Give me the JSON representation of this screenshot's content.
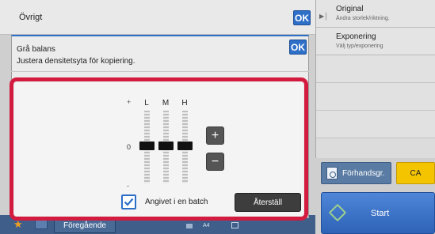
{
  "background": {
    "title": "Övrigt",
    "ok_label": "OK",
    "right_panel": {
      "items": [
        {
          "title": "Original",
          "subtitle": "Ändra storlek/riktning."
        },
        {
          "title": "Exponering",
          "subtitle": "Välj typ/exponering"
        }
      ]
    },
    "preview_label": "Förhandsgr.",
    "ca_label": "CA",
    "start_label": "Start",
    "bottom_bar": {
      "previous_label": "Föregående",
      "paper_size": "A4"
    }
  },
  "dialog": {
    "title": "Grå balans",
    "ok_label": "OK",
    "description": "Justera densitetsyta för kopiering.",
    "scale": {
      "plus": "+",
      "zero": "0",
      "minus": "-"
    },
    "channels": [
      {
        "label": "L",
        "value": 0
      },
      {
        "label": "M",
        "value": 0
      },
      {
        "label": "H",
        "value": 0
      }
    ],
    "plus_button": "+",
    "minus_button": "−",
    "batch_checkbox": {
      "label": "Angivet i en batch",
      "checked": true
    },
    "reset_label": "Återställ"
  },
  "colors": {
    "accent": "#2e6fc8",
    "highlight": "#d31b3f",
    "ca": "#f5c400",
    "start": "#2e63b7"
  }
}
